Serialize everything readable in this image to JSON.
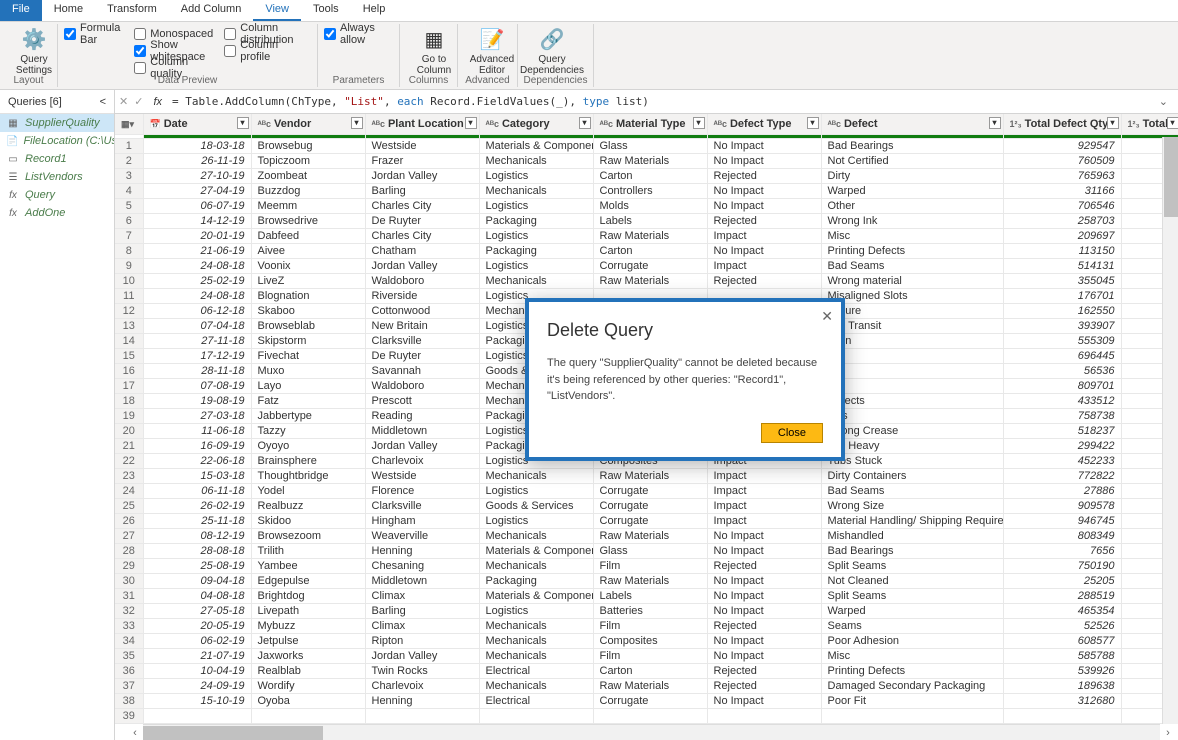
{
  "menu": {
    "file": "File",
    "home": "Home",
    "transform": "Transform",
    "addcol": "Add Column",
    "view": "View",
    "tools": "Tools",
    "help": "Help"
  },
  "ribbon": {
    "querySettings": "Query\nSettings",
    "formulaBar": "Formula Bar",
    "monospaced": "Monospaced",
    "showWhitespace": "Show whitespace",
    "columnQuality": "Column quality",
    "columnDistribution": "Column distribution",
    "columnProfile": "Column profile",
    "alwaysAllow": "Always allow",
    "goToColumn": "Go to\nColumn",
    "advancedEditor": "Advanced\nEditor",
    "queryDependencies": "Query\nDependencies",
    "groups": {
      "layout": "Layout",
      "dataPreview": "Data Preview",
      "columns": "Columns",
      "parameters": "Parameters",
      "advanced": "Advanced",
      "dependencies": "Dependencies"
    }
  },
  "sidebar": {
    "header": "Queries [6]",
    "items": [
      {
        "name": "SupplierQuality",
        "icon": "table"
      },
      {
        "name": "FileLocation (C:\\Users...",
        "icon": "text"
      },
      {
        "name": "Record1",
        "icon": "record"
      },
      {
        "name": "ListVendors",
        "icon": "list"
      },
      {
        "name": "Query",
        "icon": "fx"
      },
      {
        "name": "AddOne",
        "icon": "fx"
      }
    ]
  },
  "formula": {
    "prefix": "= Table.AddColumn(ChType, ",
    "str1": "\"List\"",
    "mid": ", ",
    "kw1": "each",
    "mid2": " Record.FieldValues(_), ",
    "kw2": "type",
    "mid3": " list)"
  },
  "columns": [
    "",
    "Date",
    "Vendor",
    "Plant Location",
    "Category",
    "Material Type",
    "Defect Type",
    "Defect",
    "Total Defect Qty",
    "Total Dow"
  ],
  "col_prefixes": [
    "",
    "📅",
    "ᴬᴮc",
    "ᴬᴮc",
    "ᴬᴮc",
    "ᴬᴮc",
    "ᴬᴮc",
    "ᴬᴮc",
    "1²₃",
    "1²₃"
  ],
  "rows": [
    [
      "18-03-18",
      "Browsebug",
      "Westside",
      "Materials & Components",
      "Glass",
      "No Impact",
      "Bad Bearings",
      "929547"
    ],
    [
      "26-11-19",
      "Topiczoom",
      "Frazer",
      "Mechanicals",
      "Raw Materials",
      "No Impact",
      "Not Certified",
      "760509"
    ],
    [
      "27-10-19",
      "Zoombeat",
      "Jordan Valley",
      "Logistics",
      "Carton",
      "Rejected",
      "Dirty",
      "765963"
    ],
    [
      "27-04-19",
      "Buzzdog",
      "Barling",
      "Mechanicals",
      "Controllers",
      "No Impact",
      "Warped",
      "31166"
    ],
    [
      "06-07-19",
      "Meemm",
      "Charles City",
      "Logistics",
      "Molds",
      "No Impact",
      "Other",
      "706546"
    ],
    [
      "14-12-19",
      "Browsedrive",
      "De Ruyter",
      "Packaging",
      "Labels",
      "Rejected",
      "Wrong Ink",
      "258703"
    ],
    [
      "20-01-19",
      "Dabfeed",
      "Charles City",
      "Logistics",
      "Raw Materials",
      "Impact",
      "Misc",
      "209697"
    ],
    [
      "21-06-19",
      "Aivee",
      "Chatham",
      "Packaging",
      "Carton",
      "No Impact",
      "Printing Defects",
      "113150"
    ],
    [
      "24-08-18",
      "Voonix",
      "Jordan Valley",
      "Logistics",
      "Corrugate",
      "Impact",
      "Bad Seams",
      "514131"
    ],
    [
      "25-02-19",
      "LiveZ",
      "Waldoboro",
      "Mechanicals",
      "Raw Materials",
      "Rejected",
      "Wrong material",
      "355045"
    ],
    [
      "24-08-18",
      "Blognation",
      "Riverside",
      "Logistics",
      "",
      "",
      "Misaligned Slots",
      "176701"
    ],
    [
      "06-12-18",
      "Skaboo",
      "Cottonwood",
      "Mechanic",
      "",
      "",
      "Failure",
      "162550"
    ],
    [
      "07-04-18",
      "Browseblab",
      "New Britain",
      "Logistics",
      "",
      "",
      "d in Transit",
      "393907"
    ],
    [
      "27-11-18",
      "Skipstorm",
      "Clarksville",
      "Packaging",
      "",
      "",
      "ation",
      "555309"
    ],
    [
      "17-12-19",
      "Fivechat",
      "De Ruyter",
      "Logistics",
      "",
      "",
      "ck",
      "696445"
    ],
    [
      "28-11-18",
      "Muxo",
      "Savannah",
      "Goods & S",
      "",
      "",
      "ms",
      "56536"
    ],
    [
      "07-08-19",
      "Layo",
      "Waldoboro",
      "Mechanic",
      "",
      "",
      "",
      "809701"
    ],
    [
      "19-08-19",
      "Fatz",
      "Prescott",
      "Mechanic",
      "",
      "",
      "Defects",
      "433512"
    ],
    [
      "27-03-18",
      "Jabbertype",
      "Reading",
      "Packaging",
      "",
      "",
      "ects",
      "758738"
    ],
    [
      "11-06-18",
      "Tazzy",
      "Middletown",
      "Logistics",
      "Corrugate",
      "Impact",
      "Wrong Crease",
      "518237"
    ],
    [
      "16-09-19",
      "Oyoyo",
      "Jordan Valley",
      "Packaging",
      "Carton",
      "Impact",
      "Too Heavy",
      "299422"
    ],
    [
      "22-06-18",
      "Brainsphere",
      "Charlevoix",
      "Logistics",
      "Composites",
      "Impact",
      "Tubs Stuck",
      "452233"
    ],
    [
      "15-03-18",
      "Thoughtbridge",
      "Westside",
      "Mechanicals",
      "Raw Materials",
      "Impact",
      "Dirty Containers",
      "772822"
    ],
    [
      "06-11-18",
      "Yodel",
      "Florence",
      "Logistics",
      "Corrugate",
      "Impact",
      "Bad Seams",
      "27886"
    ],
    [
      "26-02-19",
      "Realbuzz",
      "Clarksville",
      "Goods & Services",
      "Corrugate",
      "Impact",
      "Wrong  Size",
      "909578"
    ],
    [
      "25-11-18",
      "Skidoo",
      "Hingham",
      "Logistics",
      "Corrugate",
      "Impact",
      "Material Handling/ Shipping Requirements Error",
      "946745"
    ],
    [
      "08-12-19",
      "Browsezoom",
      "Weaverville",
      "Mechanicals",
      "Raw Materials",
      "No Impact",
      "Mishandled",
      "808349"
    ],
    [
      "28-08-18",
      "Trilith",
      "Henning",
      "Materials & Components",
      "Glass",
      "No Impact",
      "Bad Bearings",
      "7656"
    ],
    [
      "25-08-19",
      "Yambee",
      "Chesaning",
      "Mechanicals",
      "Film",
      "Rejected",
      "Split Seams",
      "750190"
    ],
    [
      "09-04-18",
      "Edgepulse",
      "Middletown",
      "Packaging",
      "Raw Materials",
      "No Impact",
      "Not Cleaned",
      "25205"
    ],
    [
      "04-08-18",
      "Brightdog",
      "Climax",
      "Materials & Components",
      "Labels",
      "No Impact",
      "Split Seams",
      "288519"
    ],
    [
      "27-05-18",
      "Livepath",
      "Barling",
      "Logistics",
      "Batteries",
      "No Impact",
      "Warped",
      "465354"
    ],
    [
      "20-05-19",
      "Mybuzz",
      "Climax",
      "Mechanicals",
      "Film",
      "Rejected",
      "Seams",
      "52526"
    ],
    [
      "06-02-19",
      "Jetpulse",
      "Ripton",
      "Mechanicals",
      "Composites",
      "No Impact",
      "Poor  Adhesion",
      "608577"
    ],
    [
      "21-07-19",
      "Jaxworks",
      "Jordan Valley",
      "Mechanicals",
      "Film",
      "No Impact",
      "Misc",
      "585788"
    ],
    [
      "10-04-19",
      "Realblab",
      "Twin Rocks",
      "Electrical",
      "Carton",
      "Rejected",
      "Printing Defects",
      "539926"
    ],
    [
      "24-09-19",
      "Wordify",
      "Charlevoix",
      "Mechanicals",
      "Raw Materials",
      "Rejected",
      "Damaged Secondary Packaging",
      "189638"
    ],
    [
      "15-10-19",
      "Oyoba",
      "Henning",
      "Electrical",
      "Corrugate",
      "No Impact",
      "Poor Fit",
      "312680"
    ],
    [
      "",
      "",
      "",
      "",
      "",
      "",
      "",
      ""
    ]
  ],
  "dialog": {
    "title": "Delete Query",
    "message": "The query \"SupplierQuality\" cannot be deleted because it's being referenced by other queries: \"Record1\", \"ListVendors\".",
    "close": "Close"
  }
}
